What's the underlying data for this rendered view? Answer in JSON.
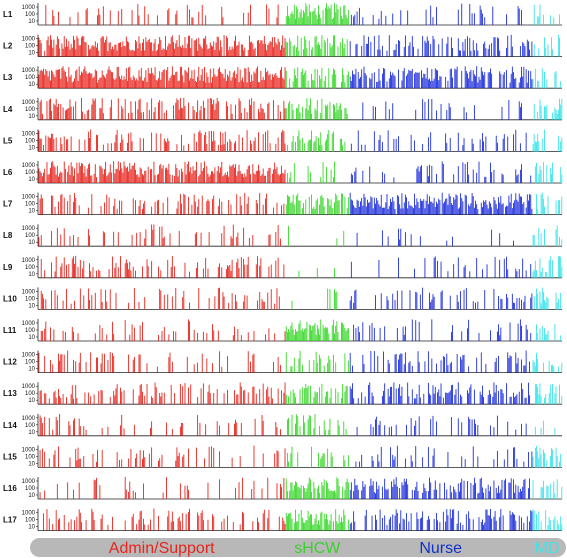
{
  "chart_data": {
    "type": "bar",
    "scale": "log",
    "y_ticks": [
      "1000",
      "100",
      "10"
    ],
    "grid": false,
    "rows": [
      {
        "label": "L1",
        "density": [
          0.25,
          0.85,
          0.15,
          0.35
        ]
      },
      {
        "label": "L2",
        "density": [
          0.95,
          0.65,
          0.45,
          0.25
        ]
      },
      {
        "label": "L3",
        "density": [
          0.98,
          0.7,
          0.7,
          0.45
        ]
      },
      {
        "label": "L4",
        "density": [
          0.55,
          0.8,
          0.15,
          0.55
        ]
      },
      {
        "label": "L5",
        "density": [
          0.4,
          0.55,
          0.25,
          0.5
        ]
      },
      {
        "label": "L6",
        "density": [
          0.9,
          0.2,
          0.25,
          0.45
        ]
      },
      {
        "label": "L7",
        "density": [
          0.3,
          0.75,
          0.95,
          0.4
        ]
      },
      {
        "label": "L8",
        "density": [
          0.2,
          0.05,
          0.1,
          0.3
        ]
      },
      {
        "label": "L9",
        "density": [
          0.35,
          0.1,
          0.15,
          0.55
        ]
      },
      {
        "label": "L10",
        "density": [
          0.25,
          0.1,
          0.3,
          0.5
        ]
      },
      {
        "label": "L11",
        "density": [
          0.2,
          0.9,
          0.2,
          0.45
        ]
      },
      {
        "label": "L12",
        "density": [
          0.3,
          0.4,
          0.35,
          0.55
        ]
      },
      {
        "label": "L13",
        "density": [
          0.45,
          0.55,
          0.55,
          0.5
        ]
      },
      {
        "label": "L14",
        "density": [
          0.2,
          0.4,
          0.2,
          0.45
        ]
      },
      {
        "label": "L15",
        "density": [
          0.2,
          0.35,
          0.25,
          0.5
        ]
      },
      {
        "label": "L16",
        "density": [
          0.2,
          0.8,
          0.6,
          0.45
        ]
      },
      {
        "label": "L17",
        "density": [
          0.35,
          0.8,
          0.5,
          0.55
        ]
      }
    ],
    "groups": [
      {
        "name": "Admin/Support",
        "color": "#e8251c",
        "bar_color": "#e61a12",
        "share": 0.472
      },
      {
        "name": "sHCW",
        "color": "#3bd02e",
        "bar_color": "#2fd61f",
        "share": 0.122
      },
      {
        "name": "Nurse",
        "color": "#1131c8",
        "bar_color": "#1224d8",
        "share": 0.349
      },
      {
        "name": "MD",
        "color": "#44e2e8",
        "bar_color": "#2fe3ea",
        "share": 0.057
      }
    ],
    "legend_position": "bottom",
    "legend_bar_color": "#b8b8b8"
  }
}
